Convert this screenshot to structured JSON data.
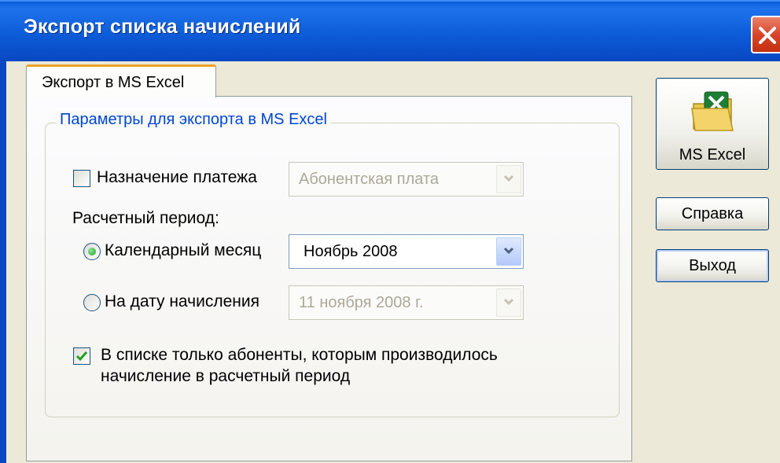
{
  "window": {
    "title": "Экспорт списка начислений"
  },
  "tabs": [
    {
      "label": "Экспорт в MS Excel"
    }
  ],
  "group": {
    "legend": "Параметры для экспорта в MS Excel",
    "payment_purpose": {
      "label": "Назначение платежа",
      "checked": false,
      "value": "Абонентская плата",
      "enabled": false
    },
    "period_label": "Расчетный период:",
    "calendar_month": {
      "label": "Календарный месяц",
      "selected": true,
      "value": "Ноябрь  2008"
    },
    "on_date": {
      "label": "На дату начисления",
      "selected": false,
      "value": "11  ноября  2008 г."
    },
    "only_charged": {
      "checked": true,
      "line1": "В списке только абоненты, которым производилось",
      "line2": "начисление в расчетный период"
    }
  },
  "buttons": {
    "excel": "MS Excel",
    "help": "Справка",
    "exit": "Выход"
  },
  "icons": {
    "close": "close-icon",
    "excel": "excel-folder-icon",
    "dropdown": "chevron-down-icon",
    "check": "checkmark-icon"
  },
  "colors": {
    "titlebar": "#0a5ede",
    "accent_tab": "#f0a228",
    "legend_text": "#0046d5",
    "close": "#d8452b"
  }
}
